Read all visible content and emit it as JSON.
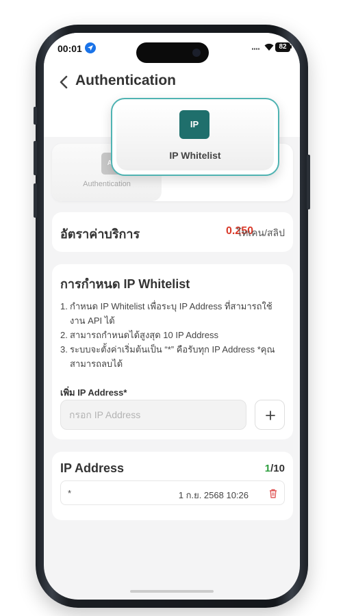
{
  "status_bar": {
    "time": "00:01",
    "battery": "82"
  },
  "header": {
    "title": "Authentication"
  },
  "tabs": [
    {
      "icon_text": "Aut",
      "label": "Authentication",
      "selected": false
    },
    {
      "icon_text": "IP",
      "label": "IP Whitelist",
      "selected": true
    }
  ],
  "rate": {
    "label": "อัตราค่าบริการ",
    "value": "0.250",
    "unit": "โทเคน/สลิป"
  },
  "whitelist": {
    "title": "การกำหนด IP Whitelist",
    "rules": [
      {
        "num": "1.",
        "text": "กำหนด IP Whitelist เพื่อระบุ IP Address ที่สามารถใช้งาน API ได้"
      },
      {
        "num": "2.",
        "text": "สามารถกำหนดได้สูงสุด 10 IP Address"
      },
      {
        "num": "3.",
        "text": "ระบบจะตั้งค่าเริ่มต้นเป็น “*” คือรับทุก IP Address *คุณสามารถลบได้"
      }
    ],
    "add_label": "เพิ่ม IP Address*",
    "input_placeholder": "กรอก IP Address",
    "input_value": ""
  },
  "ip_list": {
    "title": "IP Address",
    "count_current": "1",
    "count_max": "/10",
    "entries": [
      {
        "ip": "*",
        "date": "1 ก.ย. 2568 10:26"
      }
    ]
  },
  "colors": {
    "accent": "#1f6f6c",
    "selected_border": "#4fb3b2",
    "rate_value": "#d93a2a",
    "count_current": "#2e9e3e",
    "delete_icon": "#e05a5a"
  }
}
